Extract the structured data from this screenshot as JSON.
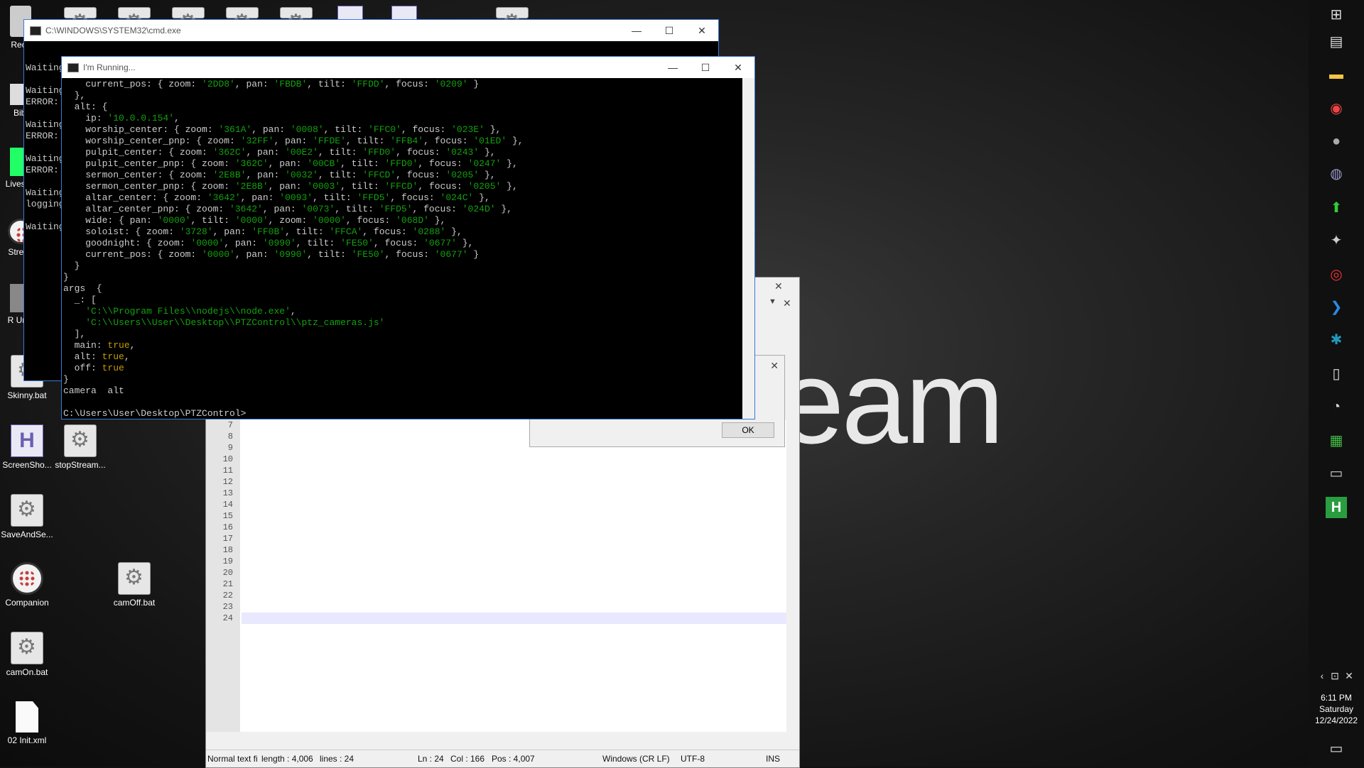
{
  "wallpaper_text": "eam",
  "desktop_icons": [
    "Recy",
    "Bibl",
    "Lives St",
    "Strean",
    "R Unin",
    "Skinny.bat",
    "ScreenSho...",
    "stopStream...",
    "SaveAndSe...",
    "Companion",
    "camOff.bat",
    "camOn.bat",
    "02 Init.xml"
  ],
  "cmd_window": {
    "title": "C:\\WINDOWS\\SYSTEM32\\cmd.exe",
    "lines": [
      "Waiting",
      "Waiting",
      "ERROR:",
      "Waiting",
      "ERROR:",
      "Waiting",
      "ERROR:",
      "Waiting",
      "logging",
      "Waiting"
    ]
  },
  "running_window": {
    "title": "I'm Running...",
    "prompt": "C:\\Users\\User\\Desktop\\PTZControl>"
  },
  "notepad": {
    "line_numbers": [
      "7",
      "8",
      "9",
      "10",
      "11",
      "12",
      "13",
      "14",
      "15",
      "16",
      "17",
      "18",
      "19",
      "20",
      "21",
      "22",
      "23",
      "24"
    ],
    "status": {
      "type": "Normal text fi",
      "length": "length : 4,006",
      "lines": "lines : 24",
      "ln": "Ln : 24",
      "col": "Col : 166",
      "pos": "Pos : 4,007",
      "eol": "Windows (CR LF)",
      "encoding": "UTF-8",
      "mode": "INS"
    }
  },
  "dialog": {
    "ok_label": "OK"
  },
  "tray": {
    "time": "6:11 PM",
    "day": "Saturday",
    "date": "12/24/2022"
  },
  "taskbar_icons": [
    "windows-icon",
    "task-view-icon",
    "file-explorer-icon",
    "chrome-icon",
    "obs-icon",
    "app-icon",
    "upload-icon",
    "network-icon",
    "cast-icon",
    "vscode-icon",
    "docker-icon",
    "notepad-icon",
    "clock-icon",
    "spreadsheet-icon",
    "terminal-icon",
    "h-app-icon"
  ]
}
